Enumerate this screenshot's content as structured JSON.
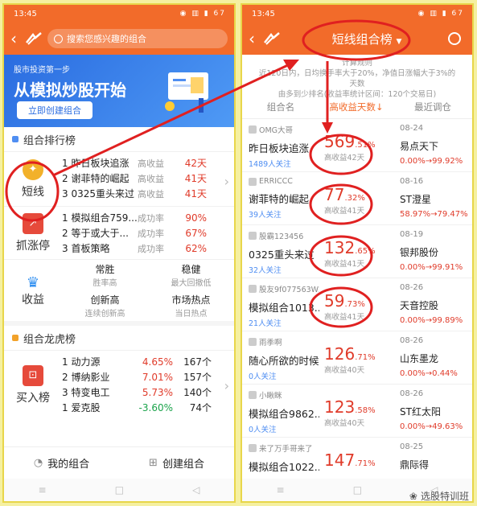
{
  "left": {
    "status_time": "13:45",
    "status_icons": "◉ ▥ ▮ 67",
    "search_placeholder": "搜索您感兴趣的组合",
    "banner": {
      "sub": "股市投资第一步",
      "title": "从模拟炒股开始",
      "button": "立即创建组合"
    },
    "rank_section": "组合排行榜",
    "short": {
      "label": "短线",
      "rows": [
        {
          "name": "1 昨日板块追涨",
          "key": "高收益",
          "val": "42天"
        },
        {
          "name": "2 谢菲特的崛起",
          "key": "高收益",
          "val": "41天"
        },
        {
          "name": "3 0325重头来过",
          "key": "高收益",
          "val": "41天"
        }
      ]
    },
    "zt": {
      "label": "抓涨停",
      "rows": [
        {
          "name": "1 模拟组合759...",
          "key": "成功率",
          "val": "90%"
        },
        {
          "name": "2 等于或大于...",
          "key": "成功率",
          "val": "67%"
        },
        {
          "name": "3 首板策略",
          "key": "成功率",
          "val": "62%"
        }
      ]
    },
    "income": {
      "label": "收益",
      "cells": [
        {
          "t": "常胜",
          "s": "胜率高"
        },
        {
          "t": "稳健",
          "s": "最大回撤低"
        },
        {
          "t": "创新高",
          "s": "连续创新高"
        },
        {
          "t": "市场热点",
          "s": "当日热点"
        }
      ]
    },
    "lhb_section": "组合龙虎榜",
    "buy": {
      "label": "买入榜",
      "rows": [
        {
          "name": "1 动力源",
          "p": "4.65%",
          "c": "167个"
        },
        {
          "name": "2 博纳影业",
          "p": "7.01%",
          "c": "157个"
        },
        {
          "name": "3 特变电工",
          "p": "5.73%",
          "c": "140个"
        },
        {
          "name": "1 爱克股",
          "p": "-3.60%",
          "c": "74个"
        }
      ]
    },
    "bottom": {
      "mine": "我的组合",
      "create": "创建组合"
    }
  },
  "right": {
    "status_time": "13:45",
    "status_icons": "◉ ▥ ▮ 67",
    "title": "短线组合榜",
    "tip_l1": "计算规则",
    "tip_l2": "近120日内，日均换手率大于20%，净值日涨幅大于3%的天数",
    "tip_l3": "由多到少排名(收益率统计区间：120个交易日)",
    "cols": {
      "name": "组合名",
      "days": "高收益天数↓",
      "recent": "最近调仓"
    },
    "items": [
      {
        "user": "OMG大哥",
        "name": "昨日板块追涨",
        "fans": "1489人关注",
        "int": "569",
        "dec": ".51%",
        "lb": "高收益42天",
        "date": "08-24",
        "stock": "易点天下",
        "change": "0.00%→99.92%"
      },
      {
        "user": "ERRICCC",
        "name": "谢菲特的崛起",
        "fans": "39人关注",
        "int": "77",
        "dec": ".32%",
        "lb": "高收益41天",
        "date": "08-16",
        "stock": "ST澄星",
        "change": "58.97%→79.47%"
      },
      {
        "user": "股霸123456",
        "name": "0325重头来过",
        "fans": "32人关注",
        "int": "132",
        "dec": ".65%",
        "lb": "高收益41天",
        "date": "08-19",
        "stock": "银邦股份",
        "change": "0.00%→99.91%"
      },
      {
        "user": "股友9f077563W2",
        "name": "模拟组合1013...",
        "fans": "21人关注",
        "int": "59",
        "dec": ".73%",
        "lb": "高收益41天",
        "date": "08-26",
        "stock": "天音控股",
        "change": "0.00%→99.89%"
      },
      {
        "user": "雨季啊",
        "name": "随心所欲的时候",
        "fans": "0人关注",
        "int": "126",
        "dec": ".71%",
        "lb": "高收益40天",
        "date": "08-26",
        "stock": "山东墨龙",
        "change": "0.00%→0.44%"
      },
      {
        "user": "小瞅眯",
        "name": "模拟组合9862...",
        "fans": "0人关注",
        "int": "123",
        "dec": ".58%",
        "lb": "高收益40天",
        "date": "08-26",
        "stock": "ST红太阳",
        "change": "0.00%→49.63%"
      },
      {
        "user": "来了万手哥来了",
        "name": "模拟组合1022...",
        "fans": "",
        "int": "147",
        "dec": ".71%",
        "lb": "",
        "date": "08-25",
        "stock": "鼎际得",
        "change": ""
      }
    ]
  },
  "watermark": "选股特训班",
  "colors": {
    "orange": "#f26b2a",
    "red": "#e03b2a",
    "blue": "#4f8ef2"
  }
}
